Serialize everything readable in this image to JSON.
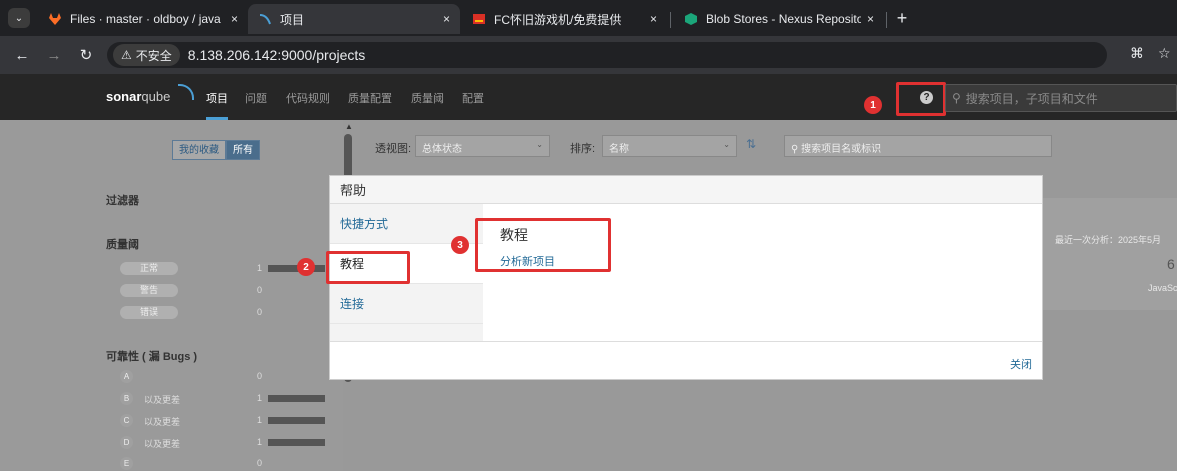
{
  "browser": {
    "tabs": [
      {
        "title": "Files · master · oldboy / java",
        "close": "×"
      },
      {
        "title": "项目",
        "close": "×"
      },
      {
        "title": "FC怀旧游戏机/免费提供",
        "close": "×"
      },
      {
        "title": "Blob Stores - Nexus Reposito",
        "close": "×"
      }
    ],
    "new_tab": "+",
    "insecure_label": "不安全",
    "url_host": "8.138.206.142",
    "url_port": ":9000",
    "url_path": "/projects"
  },
  "sonar": {
    "logo_bold": "sonar",
    "logo_light": "qube",
    "menu": [
      "项目",
      "问题",
      "代码规则",
      "质量配置",
      "质量阈",
      "配置"
    ],
    "search_placeholder": "搜索项目，子项目和文件"
  },
  "page": {
    "toggle_favorites": "我的收藏",
    "toggle_all": "所有",
    "filters_title": "过滤器",
    "quality_gate_title": "质量阈",
    "quality_gate": [
      {
        "label": "正常",
        "count": "1",
        "fill": 1.0
      },
      {
        "label": "警告",
        "count": "0",
        "fill": 0
      },
      {
        "label": "错误",
        "count": "0",
        "fill": 0
      }
    ],
    "reliability_title": "可靠性 ( 漏 Bugs )",
    "reliability": [
      {
        "grade": "A",
        "label": "",
        "count": "0",
        "fill": 0
      },
      {
        "grade": "B",
        "label": "以及更差",
        "count": "1",
        "fill": 1.0
      },
      {
        "grade": "C",
        "label": "以及更差",
        "count": "1",
        "fill": 1.0
      },
      {
        "grade": "D",
        "label": "以及更差",
        "count": "1",
        "fill": 1.0
      },
      {
        "grade": "E",
        "label": "",
        "count": "0",
        "fill": 0
      }
    ],
    "perspective_label": "透视图:",
    "perspective_value": "总体状态",
    "sort_label": "排序:",
    "sort_value": "名称",
    "project_search_placeholder": "搜索项目名或标识",
    "project_last_analysis": "最近一次分析：2025年5月",
    "project_number": "6",
    "project_language": "JavaSc"
  },
  "modal": {
    "title": "帮助",
    "sidebar": [
      "快捷方式",
      "教程",
      "连接"
    ],
    "content_title": "教程",
    "content_link": "分析新项目",
    "close_label": "关闭"
  },
  "annotations": [
    "1",
    "2",
    "3"
  ]
}
